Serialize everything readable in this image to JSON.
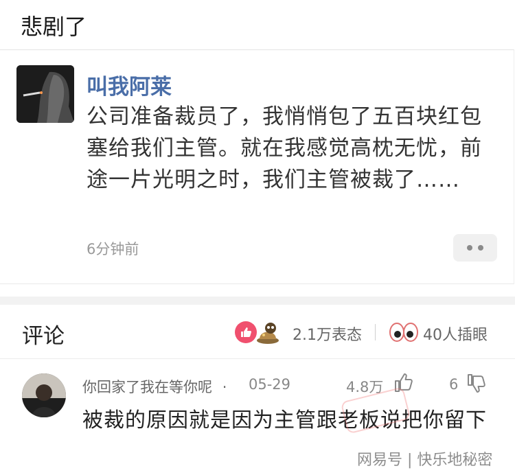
{
  "page_title": "悲剧了",
  "post": {
    "author": "叫我阿莱",
    "text": "公司准备裁员了，我悄悄包了五百块红包塞给我们主管。就在我感觉高枕无忧，前途一片光明之时，我们主管被裁了……",
    "time": "6分钟前",
    "more_icon": "more-dots-icon"
  },
  "comments_section": {
    "title": "评论",
    "reaction_count": "2.1万表态",
    "eyes_count": "40人插眼"
  },
  "comment": {
    "username": "你回家了我在等你呢",
    "separator": "·",
    "date": "05-29",
    "like_count": "4.8万",
    "dislike_count": "6",
    "text": "被裁的原因就是因为主管跟老板说把你留下"
  },
  "watermark": "网易号 | 快乐地秘密",
  "colors": {
    "author_blue": "#4a6ea8",
    "like_pink": "#f0506e"
  }
}
